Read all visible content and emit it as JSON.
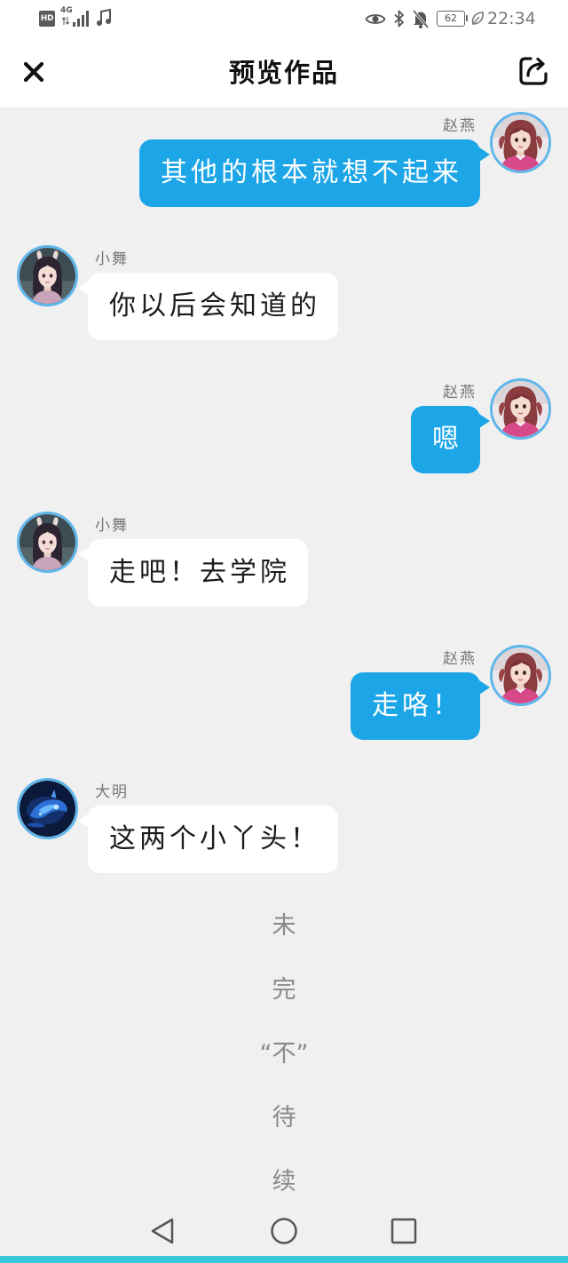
{
  "status_bar": {
    "hd_label": "HD",
    "network_label": "4G",
    "battery_level": "62",
    "time": "22:34",
    "icons": {
      "hd": "hd-icon",
      "signal": "signal-icon",
      "music": "music-note-icon",
      "eye": "eye-icon",
      "bluetooth": "bluetooth-icon",
      "mute": "bell-off-icon",
      "battery": "battery-icon",
      "eco": "leaf-icon"
    }
  },
  "header": {
    "title": "预览作品",
    "close_icon": "close-icon",
    "share_icon": "share-icon"
  },
  "messages": [
    {
      "sender": "赵燕",
      "text": "其他的根本就想不起来",
      "avatar_icon": "zhao-yan-avatar"
    },
    {
      "sender": "小舞",
      "text": "你以后会知道的",
      "avatar_icon": "xiao-wu-avatar"
    },
    {
      "sender": "赵燕",
      "text": "嗯",
      "avatar_icon": "zhao-yan-avatar"
    },
    {
      "sender": "小舞",
      "text": "走吧！去学院",
      "avatar_icon": "xiao-wu-avatar"
    },
    {
      "sender": "赵燕",
      "text": "走咯！",
      "avatar_icon": "zhao-yan-avatar"
    },
    {
      "sender": "大明",
      "text": "这两个小丫头！",
      "avatar_icon": "da-ming-avatar"
    }
  ],
  "ending": [
    "未",
    "完",
    "“不”",
    "待",
    "续"
  ],
  "nav_bar": {
    "back_icon": "back-icon",
    "home_icon": "home-icon",
    "recents_icon": "recents-icon"
  },
  "colors": {
    "header_bg": "#ffffff",
    "chat_bg": "#f0f0f0",
    "outgoing_bubble": "#1ca6e8",
    "incoming_bubble": "#ffffff",
    "avatar_ring": "#5fb6ea",
    "bottom_strip": "#38c8de"
  }
}
